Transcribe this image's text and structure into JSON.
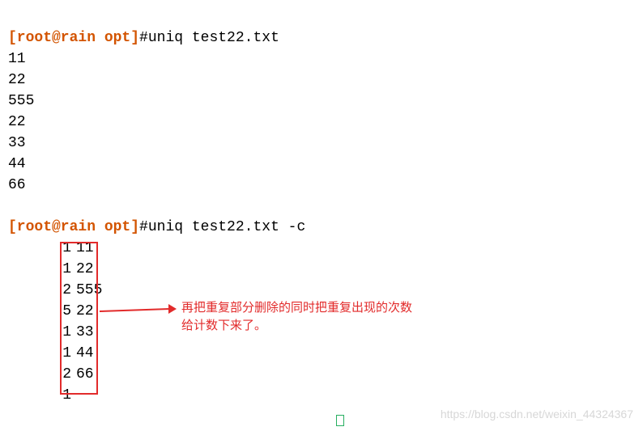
{
  "prompt1": {
    "user_host": "[root@rain opt]",
    "symbol": "#",
    "command": "uniq test22.txt"
  },
  "output1": [
    "11",
    "22",
    "555",
    "22",
    "33",
    "44",
    "66"
  ],
  "prompt2": {
    "user_host": "[root@rain opt]",
    "symbol": "#",
    "command": "uniq test22.txt -c"
  },
  "output2": [
    {
      "count": "1",
      "value": "11"
    },
    {
      "count": "1",
      "value": "22"
    },
    {
      "count": "2",
      "value": "555"
    },
    {
      "count": "5",
      "value": "22"
    },
    {
      "count": "1",
      "value": "33"
    },
    {
      "count": "1",
      "value": "44"
    },
    {
      "count": "2",
      "value": "66"
    },
    {
      "count": "1",
      "value": ""
    }
  ],
  "annotation": {
    "line1": "再把重复部分删除的同时把重复出现的次数",
    "line2": "给计数下来了。"
  },
  "watermark": "https://blog.csdn.net/weixin_44324367"
}
